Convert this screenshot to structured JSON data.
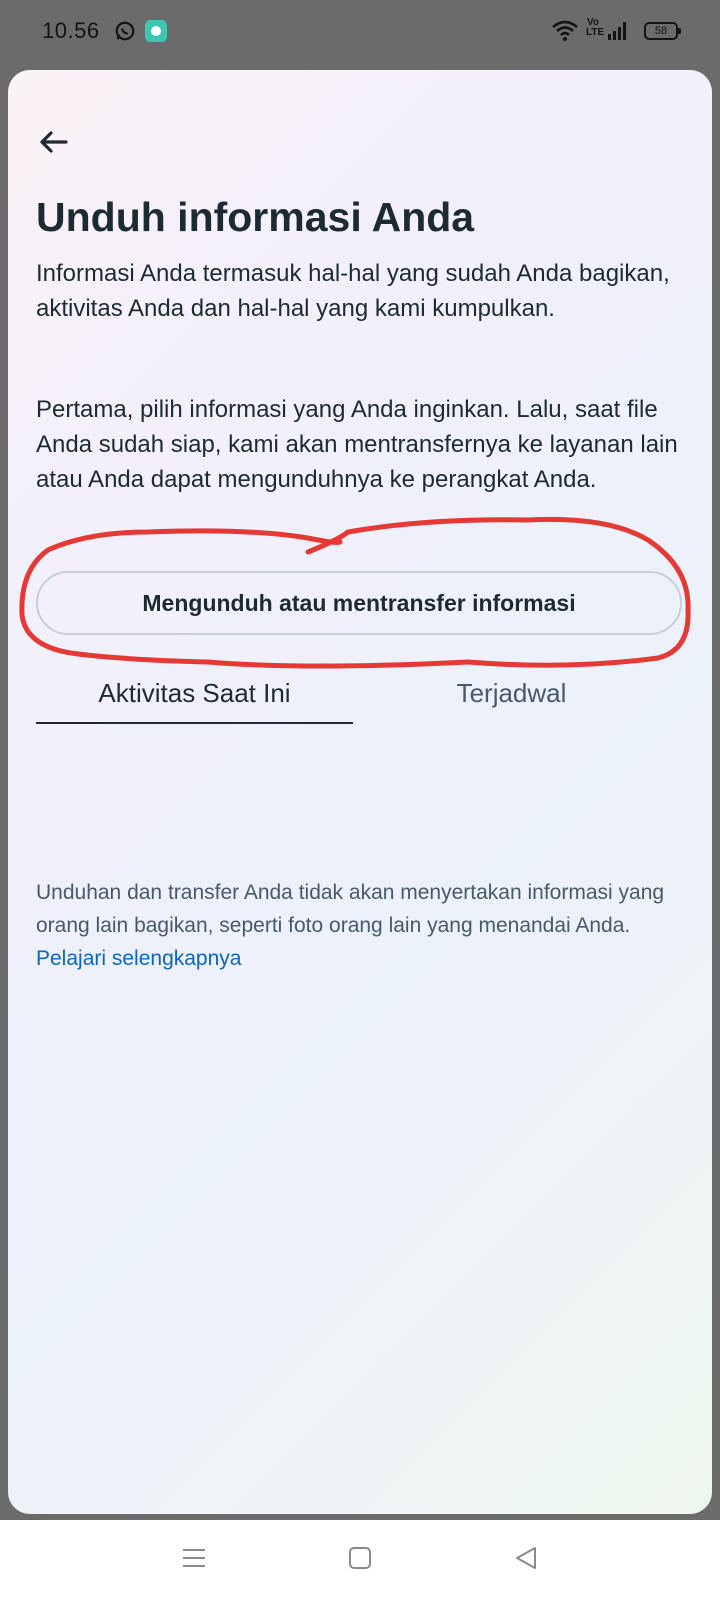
{
  "status_bar": {
    "time": "10.56",
    "volte": "Vo LTE",
    "battery": "58"
  },
  "page": {
    "title": "Unduh informasi Anda",
    "description_1": "Informasi Anda termasuk hal-hal yang sudah Anda bagikan, aktivitas Anda dan hal-hal yang kami kumpulkan.",
    "description_2": "Pertama, pilih informasi yang Anda inginkan. Lalu, saat file Anda sudah siap, kami akan mentransfernya ke layanan lain atau Anda dapat mengunduhnya ke perangkat Anda.",
    "download_button": "Mengunduh atau mentransfer informasi",
    "tabs": [
      {
        "label": "Aktivitas Saat Ini",
        "active": true
      },
      {
        "label": "Terjadwal",
        "active": false
      }
    ],
    "footnote": "Unduhan dan transfer Anda tidak akan menyertakan informasi yang orang lain bagikan, seperti foto orang lain yang menandai Anda.",
    "learn_more": "Pelajari selengkapnya"
  },
  "colors": {
    "text": "#1c2b33",
    "secondary_text": "#465a69",
    "link": "#0a66c2",
    "annotation": "#e53935"
  },
  "icons": {
    "back": "arrow-left-icon",
    "whatsapp": "whatsapp-icon",
    "wifi": "wifi-icon",
    "signal": "signal-icon",
    "nav_menu": "menu-icon",
    "nav_home": "square-home-icon",
    "nav_back": "triangle-back-icon"
  }
}
